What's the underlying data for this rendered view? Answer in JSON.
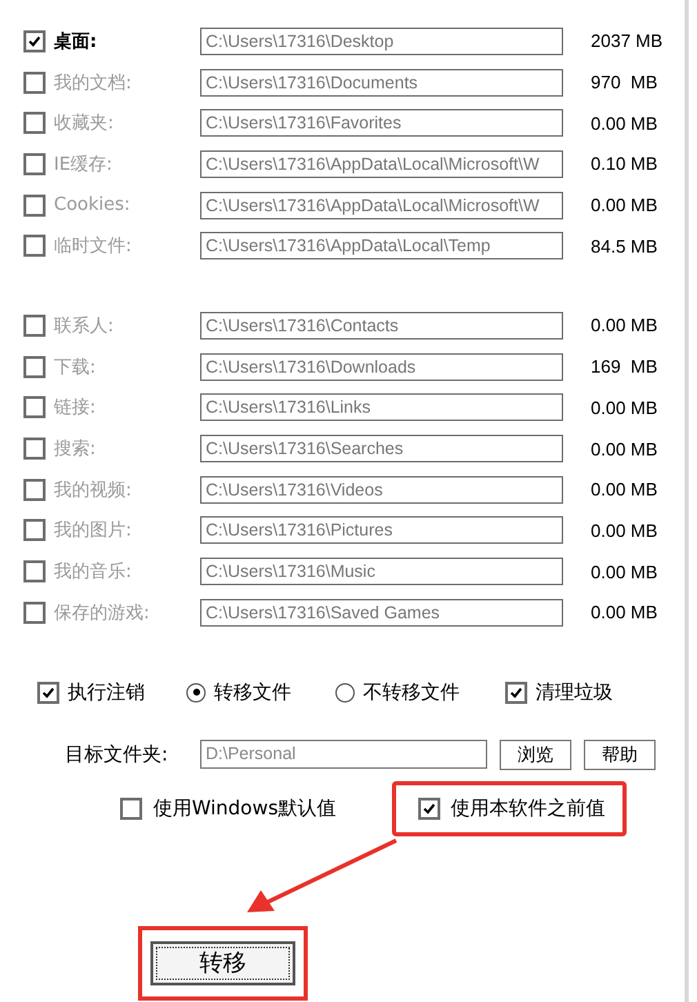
{
  "folder_groups": [
    {
      "items": [
        {
          "label": "桌面:",
          "path": "C:\\Users\\17316\\Desktop",
          "size": "2037 MB",
          "checked": true
        },
        {
          "label": "我的文档:",
          "path": "C:\\Users\\17316\\Documents",
          "size": "970  MB",
          "checked": false
        },
        {
          "label": "收藏夹:",
          "path": "C:\\Users\\17316\\Favorites",
          "size": "0.00 MB",
          "checked": false
        },
        {
          "label": "IE缓存:",
          "path": "C:\\Users\\17316\\AppData\\Local\\Microsoft\\W",
          "size": "0.10 MB",
          "checked": false
        },
        {
          "label": "Cookies:",
          "path": "C:\\Users\\17316\\AppData\\Local\\Microsoft\\W",
          "size": "0.00 MB",
          "checked": false
        },
        {
          "label": "临时文件:",
          "path": "C:\\Users\\17316\\AppData\\Local\\Temp",
          "size": "84.5 MB",
          "checked": false
        }
      ]
    },
    {
      "items": [
        {
          "label": "联系人:",
          "path": "C:\\Users\\17316\\Contacts",
          "size": "0.00 MB",
          "checked": false
        },
        {
          "label": "下载:",
          "path": "C:\\Users\\17316\\Downloads",
          "size": "169  MB",
          "checked": false
        },
        {
          "label": "链接:",
          "path": "C:\\Users\\17316\\Links",
          "size": "0.00 MB",
          "checked": false
        },
        {
          "label": "搜索:",
          "path": "C:\\Users\\17316\\Searches",
          "size": "0.00 MB",
          "checked": false
        },
        {
          "label": "我的视频:",
          "path": "C:\\Users\\17316\\Videos",
          "size": "0.00 MB",
          "checked": false
        },
        {
          "label": "我的图片:",
          "path": "C:\\Users\\17316\\Pictures",
          "size": "0.00 MB",
          "checked": false
        },
        {
          "label": "我的音乐:",
          "path": "C:\\Users\\17316\\Music",
          "size": "0.00 MB",
          "checked": false
        },
        {
          "label": "保存的游戏:",
          "path": "C:\\Users\\17316\\Saved Games",
          "size": "0.00 MB",
          "checked": false
        }
      ]
    }
  ],
  "options": [
    {
      "kind": "checkbox",
      "label": "执行注销",
      "checked": true
    },
    {
      "kind": "radio",
      "label": "转移文件",
      "checked": true
    },
    {
      "kind": "radio",
      "label": "不转移文件",
      "checked": false
    },
    {
      "kind": "checkbox",
      "label": "清理垃圾",
      "checked": true
    }
  ],
  "target": {
    "label": "目标文件夹:",
    "value": "D:\\Personal",
    "buttons": [
      "浏览",
      "帮助"
    ]
  },
  "defaults": [
    {
      "label": "使用Windows默认值",
      "checked": false,
      "highlighted": false
    },
    {
      "label": "使用本软件之前值",
      "checked": true,
      "highlighted": true
    }
  ],
  "move_button": {
    "label": "转移",
    "highlighted": true
  }
}
